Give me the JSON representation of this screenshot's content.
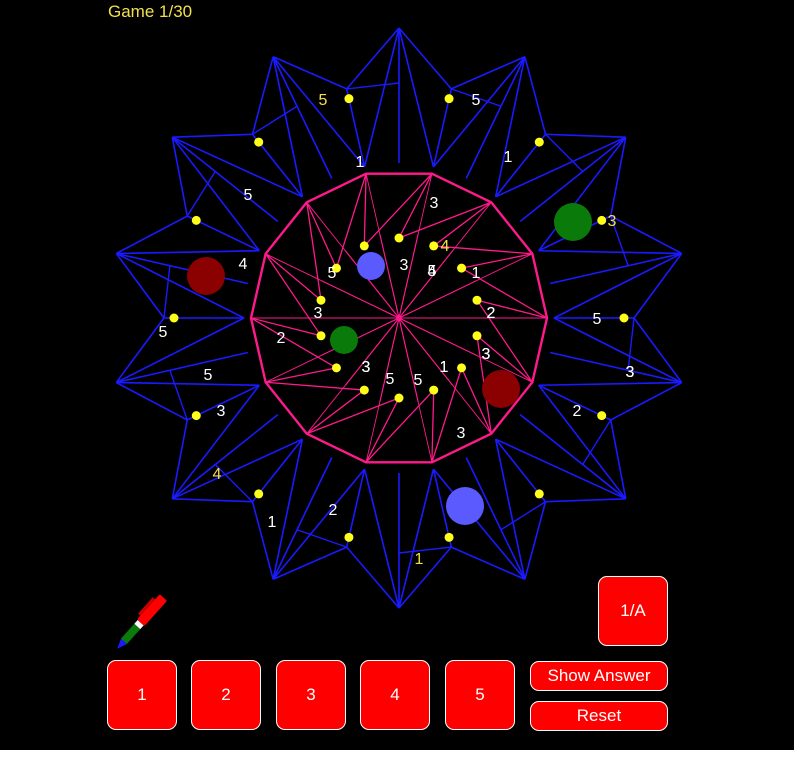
{
  "header": {
    "game_counter": "Game 1/30"
  },
  "colors": {
    "outer_lines": "#1a1aff",
    "inner_ring": "#ff1a8c",
    "nodes": "#ffff1a",
    "label_white": "#ffffff",
    "label_yellow": "#f2e04a",
    "button_red": "#ff0000",
    "piece_red": "#8b0000",
    "piece_green": "#0a7a0a",
    "piece_blue": "#5a5aff"
  },
  "board": {
    "white_labels": [
      "5",
      "1",
      "1",
      "5",
      "3",
      "4",
      "5",
      "3",
      "1",
      "4",
      "5",
      "3",
      "3",
      "3",
      "2",
      "5",
      "3",
      "1",
      "5",
      "2",
      "2",
      "3",
      "5",
      "3",
      "1",
      "2",
      "3",
      "1",
      "3",
      "5",
      "3",
      "5",
      "2"
    ],
    "yellow_labels": [
      "5",
      "3",
      "4",
      "1",
      "4"
    ],
    "pieces": [
      {
        "name": "red-piece-left",
        "color": "dark-red",
        "size": "large"
      },
      {
        "name": "red-piece-right",
        "color": "dark-red",
        "size": "large"
      },
      {
        "name": "green-piece-upper-right",
        "color": "green",
        "size": "large"
      },
      {
        "name": "green-piece-inner",
        "color": "green",
        "size": "small"
      },
      {
        "name": "blue-piece-inner",
        "color": "blue",
        "size": "small"
      },
      {
        "name": "blue-piece-lower",
        "color": "blue",
        "size": "large"
      }
    ]
  },
  "controls": {
    "number_buttons": [
      "1",
      "2",
      "3",
      "4",
      "5"
    ],
    "show_answer": "Show Answer",
    "reset": "Reset",
    "mode_toggle": "1/A",
    "pen_icon": "pen-icon"
  }
}
